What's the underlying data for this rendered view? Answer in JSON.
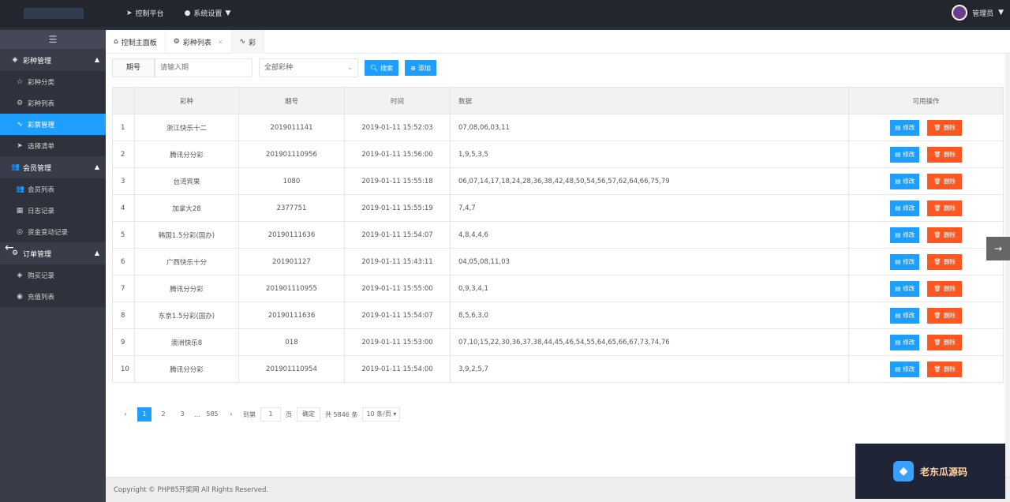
{
  "topbar": {
    "nav": [
      {
        "label": "控制平台",
        "icon": "send-icon"
      },
      {
        "label": "系统设置",
        "icon": "dot-icon",
        "caret": "▼"
      }
    ],
    "user": "管理员"
  },
  "sidebar": {
    "groups": [
      {
        "label": "彩种管理",
        "icon": "cube-icon",
        "items": [
          {
            "label": "彩种分类",
            "icon": "star-icon"
          },
          {
            "label": "彩种列表",
            "icon": "gear-icon"
          },
          {
            "label": "彩票管理",
            "icon": "pulse-icon",
            "active": true
          },
          {
            "label": "选择清单",
            "icon": "send-icon"
          }
        ]
      },
      {
        "label": "会员管理",
        "icon": "users-icon",
        "items": [
          {
            "label": "会员列表",
            "icon": "users-icon"
          },
          {
            "label": "日志记录",
            "icon": "calendar-icon"
          },
          {
            "label": "资金变动记录",
            "icon": "coin-icon"
          }
        ]
      },
      {
        "label": "订单管理",
        "icon": "gear-icon",
        "items": [
          {
            "label": "购买记录",
            "icon": "cube-icon"
          },
          {
            "label": "充值列表",
            "icon": "target-icon"
          }
        ]
      }
    ]
  },
  "tabs": [
    {
      "label": "控制主面板",
      "icon": "home-icon"
    },
    {
      "label": "彩种列表",
      "icon": "gear-icon",
      "closable": true
    },
    {
      "label": "彩",
      "icon": "pulse-icon",
      "active": true
    }
  ],
  "filter": {
    "label": "期号",
    "placeholder": "请输入期",
    "select_value": "全部彩种",
    "search_label": "搜索",
    "add_label": "添加"
  },
  "table": {
    "headers": [
      "",
      "彩种",
      "期号",
      "时间",
      "数据",
      "可用操作"
    ],
    "edit_label": "修改",
    "delete_label": "删除",
    "rows": [
      {
        "idx": "1",
        "name": "浙江快乐十二",
        "issue": "2019011141",
        "time": "2019-01-11 15:52:03",
        "data": "07,08,06,03,11"
      },
      {
        "idx": "2",
        "name": "腾讯分分彩",
        "issue": "201901110956",
        "time": "2019-01-11 15:56:00",
        "data": "1,9,5,3,5"
      },
      {
        "idx": "3",
        "name": "台湾宾果",
        "issue": "1080",
        "time": "2019-01-11 15:55:18",
        "data": "06,07,14,17,18,24,28,36,38,42,48,50,54,56,57,62,64,66,75,79"
      },
      {
        "idx": "4",
        "name": "加拿大28",
        "issue": "2377751",
        "time": "2019-01-11 15:55:19",
        "data": "7,4,7"
      },
      {
        "idx": "5",
        "name": "韩国1.5分彩(国办)",
        "issue": "20190111636",
        "time": "2019-01-11 15:54:07",
        "data": "4,8,4,4,6"
      },
      {
        "idx": "6",
        "name": "广西快乐十分",
        "issue": "201901127",
        "time": "2019-01-11 15:43:11",
        "data": "04,05,08,11,03"
      },
      {
        "idx": "7",
        "name": "腾讯分分彩",
        "issue": "201901110955",
        "time": "2019-01-11 15:55:00",
        "data": "0,9,3,4,1"
      },
      {
        "idx": "8",
        "name": "东京1.5分彩(国办)",
        "issue": "20190111636",
        "time": "2019-01-11 15:54:07",
        "data": "8,5,6,3,0"
      },
      {
        "idx": "9",
        "name": "澳洲快乐8",
        "issue": "018",
        "time": "2019-01-11 15:53:00",
        "data": "07,10,15,22,30,36,37,38,44,45,46,54,55,64,65,66,67,73,74,76"
      },
      {
        "idx": "10",
        "name": "腾讯分分彩",
        "issue": "201901110954",
        "time": "2019-01-11 15:54:00",
        "data": "3,9,2,5,7"
      }
    ]
  },
  "pager": {
    "prev": "‹",
    "pages": [
      "1",
      "2",
      "3",
      "…",
      "585"
    ],
    "next": "›",
    "goto_label": "到第",
    "goto_value": "1",
    "page_unit": "页",
    "confirm": "确定",
    "total": "共 5846 条",
    "per_page": "10 条/页"
  },
  "footer": "Copyright © PHP85开奖网 All Rights Reserved.",
  "watermark": "老东瓜源码"
}
